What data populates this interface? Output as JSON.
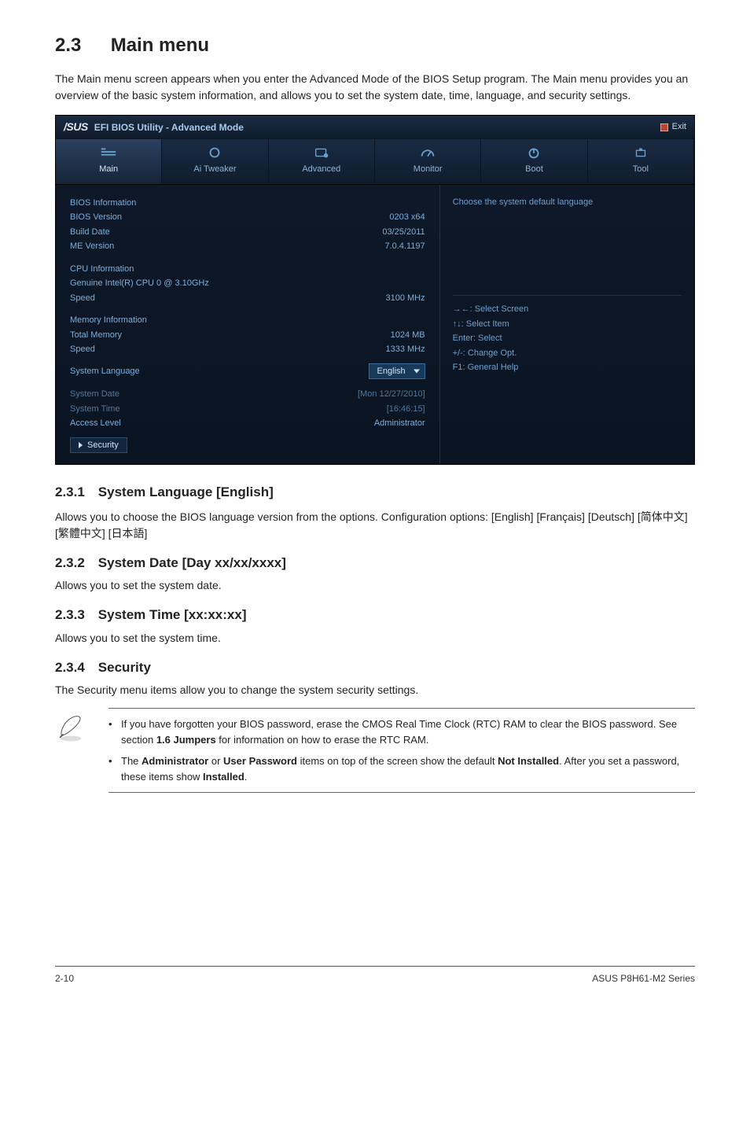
{
  "section": {
    "number": "2.3",
    "title": "Main menu",
    "intro": "The Main menu screen appears when you enter the Advanced Mode of the BIOS Setup program. The Main menu provides you an overview of the basic system information, and allows you to set the system date, time, language, and security settings."
  },
  "bios": {
    "topbar_title": "EFI BIOS Utility - Advanced Mode",
    "logo": "/SUS",
    "exit_label": "Exit",
    "tabs": {
      "main": "Main",
      "ai_tweaker": "Ai Tweaker",
      "advanced": "Advanced",
      "monitor": "Monitor",
      "boot": "Boot",
      "tool": "Tool"
    },
    "bios_info": {
      "header": "BIOS Information",
      "version_label": "BIOS Version",
      "version_value": "0203 x64",
      "build_label": "Build Date",
      "build_value": "03/25/2011",
      "me_label": "ME Version",
      "me_value": "7.0.4.1197"
    },
    "cpu_info": {
      "header": "CPU Information",
      "name": "Genuine Intel(R) CPU 0 @ 3.10GHz",
      "speed_label": "Speed",
      "speed_value": "3100 MHz"
    },
    "mem_info": {
      "header": "Memory Information",
      "total_label": "Total Memory",
      "total_value": "1024 MB",
      "speed_label": "Speed",
      "speed_value": "1333 MHz"
    },
    "sys_lang_label": "System Language",
    "sys_lang_value": "English",
    "system_date_label": "System Date",
    "system_date_value": "[Mon 12/27/2010]",
    "system_time_label": "System Time",
    "system_time_value": "[16:46:15]",
    "access_level_label": "Access Level",
    "access_level_value": "Administrator",
    "security_label": "Security",
    "help_text": "Choose the system default language",
    "hints": {
      "h1": "→←: Select Screen",
      "h2": "↑↓: Select Item",
      "h3": "Enter: Select",
      "h4": "+/-: Change Opt.",
      "h5": "F1: General Help"
    }
  },
  "sub": {
    "s231_title": "2.3.1 System Language [English]",
    "s231_body": "Allows you to choose the BIOS language version from the options. Configuration options: [English] [Français] [Deutsch] [简体中文] [繁體中文] [日本語]",
    "s232_title": "2.3.2 System Date [Day xx/xx/xxxx]",
    "s232_body": "Allows you to set the system date.",
    "s233_title": "2.3.3 System Time [xx:xx:xx]",
    "s233_body": "Allows you to set the system time.",
    "s234_title": "2.3.4 Security",
    "s234_body": "The Security menu items allow you to change the system security settings."
  },
  "notes": {
    "n1a": "If you have forgotten your BIOS password, erase the CMOS Real Time Clock (RTC) RAM to clear the BIOS password. See section ",
    "n1b": "1.6 Jumpers",
    "n1c": " for information on how to erase the RTC RAM.",
    "n2a": "The ",
    "n2b": "Administrator",
    "n2c": " or ",
    "n2d": "User Password",
    "n2e": " items on top of the screen show the default ",
    "n2f": "Not Installed",
    "n2g": ". After you set a password, these items show ",
    "n2h": "Installed",
    "n2i": "."
  },
  "footer": {
    "page": "2-10",
    "product": "ASUS P8H61-M2 Series"
  }
}
